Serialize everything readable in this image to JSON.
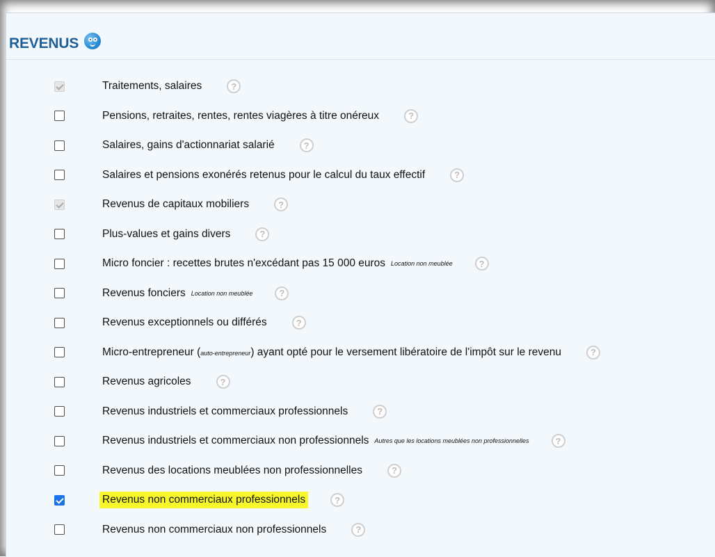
{
  "section": {
    "title": "REVENUS",
    "mascot_icon": "mascot-icon"
  },
  "help_icon_glyph": "?",
  "items": [
    {
      "label": "Traitements, salaires",
      "note": "",
      "state": "disabled-checked"
    },
    {
      "label": "Pensions, retraites, rentes, rentes viagères à titre onéreux",
      "note": "",
      "state": "unchecked"
    },
    {
      "label": "Salaires, gains d'actionnariat salarié",
      "note": "",
      "state": "unchecked"
    },
    {
      "label": "Salaires et pensions exonérés retenus pour le calcul du taux effectif",
      "note": "",
      "state": "unchecked"
    },
    {
      "label": "Revenus de capitaux mobiliers",
      "note": "",
      "state": "disabled-checked"
    },
    {
      "label": "Plus-values et gains divers",
      "note": "",
      "state": "unchecked"
    },
    {
      "label": "Micro foncier : recettes brutes n'excédant pas 15 000 euros",
      "note": "Location non meublée",
      "state": "unchecked"
    },
    {
      "label": "Revenus fonciers",
      "note": "Location non meublée",
      "state": "unchecked"
    },
    {
      "label": "Revenus exceptionnels ou différés",
      "note": "",
      "state": "unchecked"
    },
    {
      "label_before": "Micro-entrepreneur (",
      "label_small": "auto-entrepreneur",
      "label_after": ") ayant opté pour le versement libératoire de l'impôt sur le revenu",
      "note": "",
      "state": "unchecked",
      "split": true
    },
    {
      "label": "Revenus agricoles",
      "note": "",
      "state": "unchecked"
    },
    {
      "label": "Revenus industriels et commerciaux professionnels",
      "note": "",
      "state": "unchecked"
    },
    {
      "label": "Revenus industriels et commerciaux non professionnels",
      "note": "Autres que les locations meublées non professionnelles",
      "state": "unchecked"
    },
    {
      "label": "Revenus des locations meublées non professionnelles",
      "note": "",
      "state": "unchecked"
    },
    {
      "label": "Revenus non commerciaux professionnels",
      "note": "",
      "state": "checked",
      "highlight": true
    },
    {
      "label": "Revenus non commerciaux non professionnels",
      "note": "",
      "state": "unchecked"
    }
  ],
  "colors": {
    "title": "#1f5f97",
    "panel_bg": "#f3f8fd",
    "highlight": "#f7f72c",
    "checkbox_checked": "#1a73e8"
  }
}
